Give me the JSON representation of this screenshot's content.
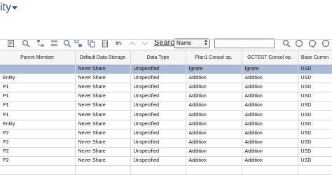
{
  "header": {
    "title": "ity"
  },
  "toolbar": {
    "search_label": "Search",
    "search_by": "Name",
    "search_value": ""
  },
  "grid": {
    "columns": [
      "Parent Member",
      "Default Data Storage",
      "Data Type",
      "Plan1 Consol op.",
      "GCTEST Consol op.",
      "Base Curren"
    ],
    "rows": [
      [
        "",
        "Never Share",
        "Unspecified",
        "Ignore",
        "Ignore",
        "USD"
      ],
      [
        "Entity",
        "Never Share",
        "Unspecified",
        "Addition",
        "Addition",
        "USD"
      ],
      [
        "P1",
        "Never Share",
        "Unspecified",
        "Addition",
        "Addition",
        "USD"
      ],
      [
        "P1",
        "Never Share",
        "Unspecified",
        "Addition",
        "Addition",
        "USD"
      ],
      [
        "P1",
        "Never Share",
        "Unspecified",
        "Addition",
        "Addition",
        "USD"
      ],
      [
        "P1",
        "Never Share",
        "Unspecified",
        "Addition",
        "Addition",
        "USD"
      ],
      [
        "Entity",
        "Never Share",
        "Unspecified",
        "Addition",
        "Addition",
        "USD"
      ],
      [
        "P2",
        "Never Share",
        "Unspecified",
        "Addition",
        "Addition",
        "USD"
      ],
      [
        "P2",
        "Never Share",
        "Unspecified",
        "Addition",
        "Addition",
        "USD"
      ],
      [
        "P2",
        "Never Share",
        "Unspecified",
        "Addition",
        "Addition",
        "USD"
      ],
      [
        "P2",
        "Never Share",
        "Unspecified",
        "Addition",
        "Addition",
        "USD"
      ],
      [
        "",
        "",
        "",
        "",
        "",
        ""
      ]
    ]
  }
}
